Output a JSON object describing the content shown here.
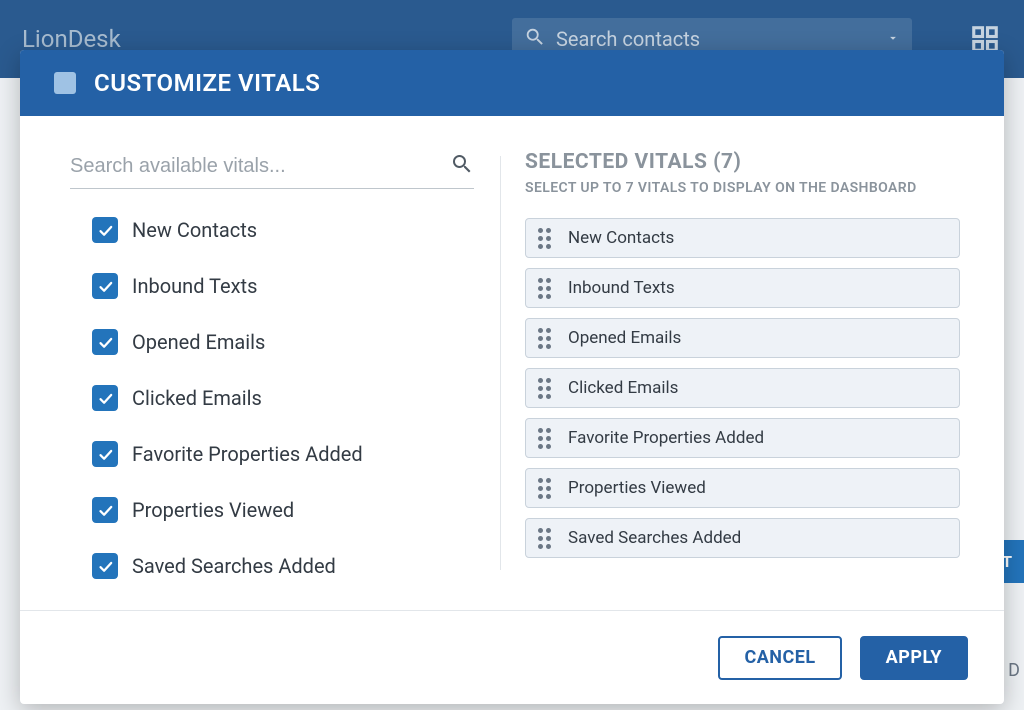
{
  "header": {
    "brand": "LionDesk",
    "search_placeholder": "Search contacts"
  },
  "background": {
    "button_fragment": "ACT",
    "text_fragment": "ed D"
  },
  "modal": {
    "title": "CUSTOMIZE VITALS",
    "search_placeholder": "Search available vitals...",
    "available": [
      "New Contacts",
      "Inbound Texts",
      "Opened Emails",
      "Clicked Emails",
      "Favorite Properties Added",
      "Properties Viewed",
      "Saved Searches Added"
    ],
    "selected_header": "SELECTED VITALS (7)",
    "selected_hint": "SELECT UP TO 7 VITALS TO DISPLAY ON THE DASHBOARD",
    "selected": [
      "New Contacts",
      "Inbound Texts",
      "Opened Emails",
      "Clicked Emails",
      "Favorite Properties Added",
      "Properties Viewed",
      "Saved Searches Added"
    ],
    "cancel_label": "CANCEL",
    "apply_label": "APPLY"
  }
}
